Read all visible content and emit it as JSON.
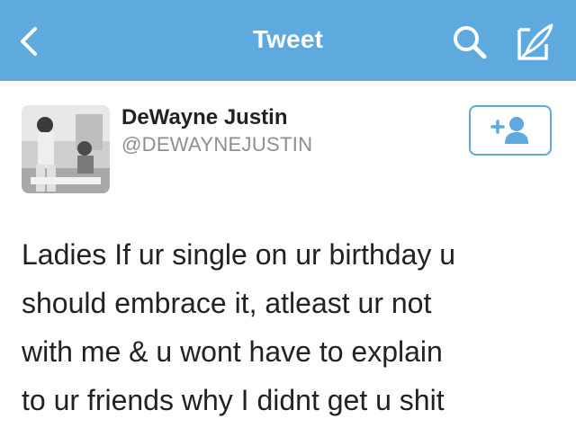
{
  "header": {
    "title": "Tweet",
    "background": "#5ea9dd",
    "icons": [
      "chevron-left-icon",
      "search-icon",
      "compose-icon"
    ]
  },
  "tweet": {
    "author": {
      "display_name": "DeWayne Justin",
      "handle": "@DEWAYNEJUSTIN"
    },
    "follow_icon": "add-user-icon",
    "text_lines": [
      "Ladies If ur single on ur birthday u",
      "should embrace it, atleast ur not",
      "with me & u wont have to explain",
      "to ur friends why I didnt get u shit"
    ]
  }
}
